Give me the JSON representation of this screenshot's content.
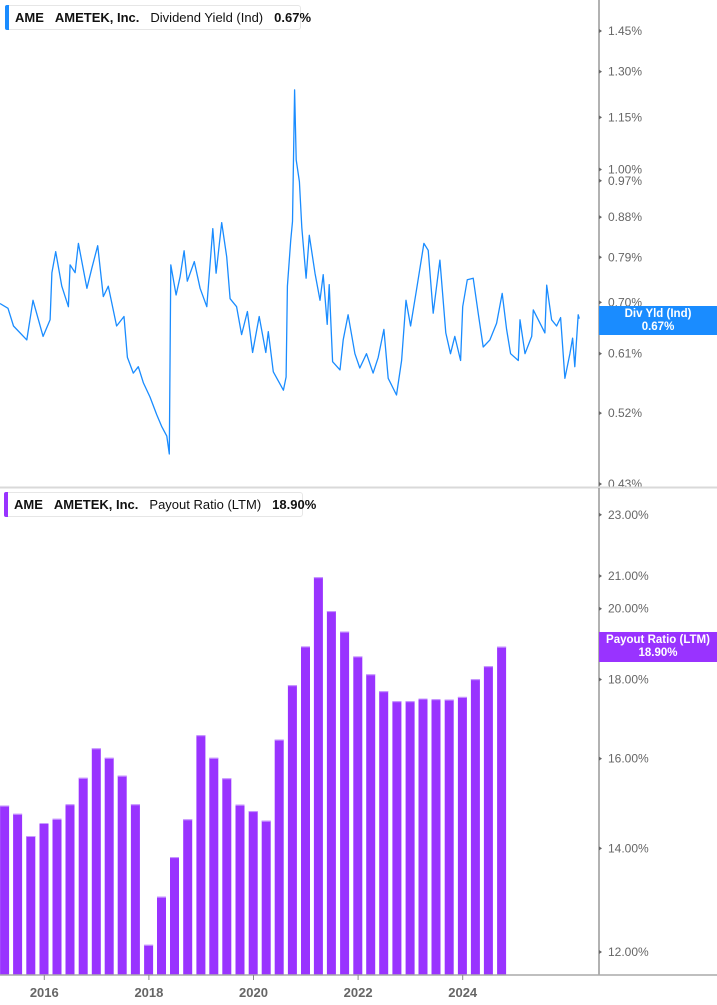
{
  "colors": {
    "yield_line": "#1a8cff",
    "payout_bar": "#9933ff",
    "axis": "#999999"
  },
  "top_legend": {
    "ticker": "AME",
    "company": "AMETEK, Inc.",
    "metric": "Dividend Yield (Ind)",
    "value": "0.67%"
  },
  "top_badge": {
    "label": "Div Yld (Ind)",
    "value": "0.67%"
  },
  "bottom_legend": {
    "ticker": "AME",
    "company": "AMETEK, Inc.",
    "metric": "Payout Ratio (LTM)",
    "value": "18.90%"
  },
  "bottom_badge": {
    "label": "Payout Ratio (LTM)",
    "value": "18.90%"
  },
  "chart_data": [
    {
      "type": "line",
      "series_name": "Dividend Yield (Ind)",
      "y_scale": "log",
      "ylim": [
        0.43,
        1.6
      ],
      "yticks": [
        1.45,
        1.3,
        1.15,
        1.0,
        0.97,
        0.88,
        0.79,
        0.7,
        0.61,
        0.52,
        0.43
      ],
      "ytick_labels": [
        "1.45%",
        "1.30%",
        "1.15%",
        "1.00%",
        "0.97%",
        "0.88%",
        "0.79%",
        "0.70%",
        "0.61%",
        "0.52%",
        "0.43%"
      ],
      "x_range": [
        "2015-03-10",
        "2025-02-04"
      ],
      "points": [
        [
          "2015-03-10",
          0.698
        ],
        [
          "2015-04-29",
          0.689
        ],
        [
          "2015-06-02",
          0.657
        ],
        [
          "2015-08-24",
          0.633
        ],
        [
          "2015-10-02",
          0.704
        ],
        [
          "2015-12-04",
          0.639
        ],
        [
          "2016-01-17",
          0.668
        ],
        [
          "2016-01-28",
          0.758
        ],
        [
          "2016-02-21",
          0.802
        ],
        [
          "2016-03-30",
          0.731
        ],
        [
          "2016-05-10",
          0.692
        ],
        [
          "2016-05-21",
          0.774
        ],
        [
          "2016-06-21",
          0.758
        ],
        [
          "2016-07-12",
          0.82
        ],
        [
          "2016-09-03",
          0.727
        ],
        [
          "2016-10-04",
          0.767
        ],
        [
          "2016-11-10",
          0.815
        ],
        [
          "2016-12-15",
          0.711
        ],
        [
          "2017-01-15",
          0.731
        ],
        [
          "2017-03-08",
          0.657
        ],
        [
          "2017-04-23",
          0.674
        ],
        [
          "2017-05-14",
          0.604
        ],
        [
          "2017-06-20",
          0.579
        ],
        [
          "2017-07-21",
          0.589
        ],
        [
          "2017-08-22",
          0.564
        ],
        [
          "2017-10-02",
          0.543
        ],
        [
          "2017-11-13",
          0.518
        ],
        [
          "2017-12-14",
          0.502
        ],
        [
          "2018-01-15",
          0.489
        ],
        [
          "2018-01-31",
          0.466
        ],
        [
          "2018-02-09",
          0.774
        ],
        [
          "2018-03-14",
          0.714
        ],
        [
          "2018-04-08",
          0.75
        ],
        [
          "2018-05-03",
          0.804
        ],
        [
          "2018-05-23",
          0.741
        ],
        [
          "2018-07-06",
          0.781
        ],
        [
          "2018-08-11",
          0.727
        ],
        [
          "2018-09-22",
          0.692
        ],
        [
          "2018-10-29",
          0.853
        ],
        [
          "2018-11-19",
          0.757
        ],
        [
          "2018-12-24",
          0.867
        ],
        [
          "2019-01-24",
          0.791
        ],
        [
          "2019-02-14",
          0.707
        ],
        [
          "2019-03-27",
          0.692
        ],
        [
          "2019-04-27",
          0.642
        ],
        [
          "2019-06-02",
          0.683
        ],
        [
          "2019-07-05",
          0.612
        ],
        [
          "2019-08-15",
          0.674
        ],
        [
          "2019-09-25",
          0.612
        ],
        [
          "2019-10-11",
          0.647
        ],
        [
          "2019-11-11",
          0.581
        ],
        [
          "2020-01-13",
          0.553
        ],
        [
          "2020-01-30",
          0.573
        ],
        [
          "2020-02-07",
          0.731
        ],
        [
          "2020-02-28",
          0.826
        ],
        [
          "2020-03-10",
          0.87
        ],
        [
          "2020-03-23",
          1.238
        ],
        [
          "2020-04-02",
          1.026
        ],
        [
          "2020-04-22",
          0.968
        ],
        [
          "2020-05-07",
          0.856
        ],
        [
          "2020-06-03",
          0.747
        ],
        [
          "2020-06-23",
          0.838
        ],
        [
          "2020-07-29",
          0.757
        ],
        [
          "2020-08-29",
          0.704
        ],
        [
          "2020-09-18",
          0.754
        ],
        [
          "2020-10-13",
          0.66
        ],
        [
          "2020-10-26",
          0.734
        ],
        [
          "2020-11-16",
          0.597
        ],
        [
          "2021-01-01",
          0.584
        ],
        [
          "2021-01-21",
          0.633
        ],
        [
          "2021-02-21",
          0.677
        ],
        [
          "2021-04-04",
          0.61
        ],
        [
          "2021-05-05",
          0.587
        ],
        [
          "2021-06-16",
          0.61
        ],
        [
          "2021-07-27",
          0.579
        ],
        [
          "2021-08-28",
          0.604
        ],
        [
          "2021-10-02",
          0.651
        ],
        [
          "2021-10-29",
          0.571
        ],
        [
          "2021-12-20",
          0.546
        ],
        [
          "2022-01-21",
          0.599
        ],
        [
          "2022-02-17",
          0.704
        ],
        [
          "2022-03-18",
          0.657
        ],
        [
          "2022-04-24",
          0.724
        ],
        [
          "2022-06-09",
          0.82
        ],
        [
          "2022-07-06",
          0.805
        ],
        [
          "2022-08-06",
          0.68
        ],
        [
          "2022-09-17",
          0.784
        ],
        [
          "2022-10-24",
          0.645
        ],
        [
          "2022-11-22",
          0.61
        ],
        [
          "2022-12-19",
          0.639
        ],
        [
          "2023-01-24",
          0.599
        ],
        [
          "2023-02-06",
          0.692
        ],
        [
          "2023-03-07",
          0.744
        ],
        [
          "2023-04-13",
          0.747
        ],
        [
          "2023-05-14",
          0.68
        ],
        [
          "2023-06-14",
          0.621
        ],
        [
          "2023-07-26",
          0.633
        ],
        [
          "2023-09-06",
          0.662
        ],
        [
          "2023-10-11",
          0.717
        ],
        [
          "2023-11-07",
          0.651
        ],
        [
          "2023-12-02",
          0.61
        ],
        [
          "2024-01-19",
          0.599
        ],
        [
          "2024-01-30",
          0.668
        ],
        [
          "2024-03-01",
          0.61
        ],
        [
          "2024-04-12",
          0.639
        ],
        [
          "2024-04-22",
          0.686
        ],
        [
          "2024-06-03",
          0.662
        ],
        [
          "2024-07-04",
          0.645
        ],
        [
          "2024-07-15",
          0.733
        ],
        [
          "2024-08-15",
          0.668
        ],
        [
          "2024-09-15",
          0.657
        ],
        [
          "2024-10-10",
          0.672
        ],
        [
          "2024-11-06",
          0.571
        ],
        [
          "2024-12-07",
          0.61
        ],
        [
          "2024-12-24",
          0.636
        ],
        [
          "2025-01-07",
          0.589
        ],
        [
          "2025-01-28",
          0.677
        ],
        [
          "2025-02-04",
          0.67
        ]
      ]
    },
    {
      "type": "bar",
      "series_name": "Payout Ratio (LTM)",
      "y_scale": "log",
      "ylim": [
        11.8,
        23.5
      ],
      "yticks": [
        23,
        21,
        20,
        18,
        16,
        14,
        12
      ],
      "ytick_labels": [
        "23.00%",
        "21.00%",
        "20.00%",
        "18.00%",
        "16.00%",
        "14.00%",
        "12.00%"
      ],
      "xticks": [
        "2016",
        "2018",
        "2020",
        "2022",
        "2024"
      ],
      "categories": [
        "2015-03-31",
        "2015-06-30",
        "2015-09-30",
        "2015-12-31",
        "2016-03-31",
        "2016-06-30",
        "2016-09-30",
        "2016-12-31",
        "2017-03-31",
        "2017-06-30",
        "2017-09-30",
        "2017-12-31",
        "2018-03-31",
        "2018-06-30",
        "2018-09-30",
        "2018-12-31",
        "2019-03-31",
        "2019-06-30",
        "2019-09-30",
        "2019-12-31",
        "2020-03-31",
        "2020-06-30",
        "2020-09-30",
        "2020-12-31",
        "2021-03-31",
        "2021-06-30",
        "2021-09-30",
        "2021-12-31",
        "2022-03-31",
        "2022-06-30",
        "2022-09-30",
        "2022-12-31",
        "2023-03-31",
        "2023-06-30",
        "2023-09-30",
        "2023-12-31",
        "2024-03-31",
        "2024-06-30",
        "2024-09-30"
      ],
      "values": [
        14.92,
        14.74,
        14.26,
        14.54,
        14.63,
        14.95,
        15.55,
        16.25,
        16.02,
        15.6,
        14.95,
        12.13,
        13.03,
        13.82,
        14.62,
        16.57,
        16.02,
        15.54,
        14.94,
        14.8,
        14.59,
        16.46,
        17.85,
        18.91,
        20.96,
        19.93,
        19.33,
        18.63,
        18.14,
        17.69,
        17.43,
        17.43,
        17.5,
        17.48,
        17.47,
        17.54,
        18.01,
        18.36,
        18.9
      ]
    }
  ]
}
